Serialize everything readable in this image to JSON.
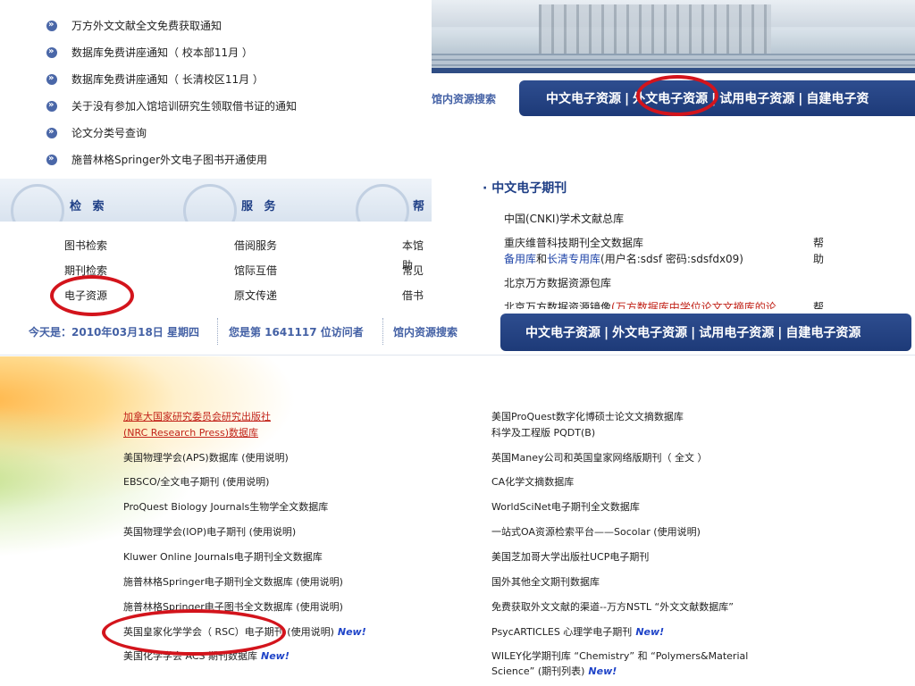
{
  "notices": [
    "万方外文文献全文免费获取通知",
    "数据库免费讲座通知（ 校本部11月 ）",
    "数据库免费讲座通知（ 长清校区11月 ）",
    "关于没有参加入馆培训研究生领取借书证的通知",
    "论文分类号查询",
    "施普林格Springer外文电子图书开通使用"
  ],
  "topnav": {
    "search_label": "馆内资源搜索",
    "items": [
      "中文电子资源",
      "外文电子资源",
      "试用电子资源",
      "自建电子资"
    ]
  },
  "menu": {
    "columns": [
      {
        "head": "检 索",
        "items": [
          "图书检索",
          "期刊检索",
          "电子资源"
        ]
      },
      {
        "head": "服 务",
        "items": [
          "借阅服务",
          "馆际互借",
          "原文传递"
        ]
      },
      {
        "head": "帮",
        "items": [
          "本馆助",
          "常见",
          "借书"
        ]
      }
    ]
  },
  "cjournal": {
    "title": "· 中文电子期刊",
    "rows": {
      "cnki": "中国(CNKI)学术文献总库",
      "weipu": "重庆维普科技期刊全文数据库",
      "backup": "备用库",
      "and": "和",
      "changqing": "长清专用库",
      "creds": "(用户名:sdsf 密码:sdsfdx09)",
      "wanfang": "北京万方数据资源包库",
      "mirror": "北京万方数据资源镜像",
      "mirror_red": "(万方数据库中学位论文文摘库的论",
      "help1": "帮",
      "help2": "助",
      "help3": "帮"
    }
  },
  "status": {
    "date": "今天是：2010年03月18日 星期四",
    "visitors": "您是第 1641117 位访问者",
    "search": "馆内资源搜索",
    "items": [
      "中文电子资源",
      "外文电子资源",
      "试用电子资源",
      "自建电子资源"
    ]
  },
  "foreign": {
    "left": {
      "nrc_line1": "加拿大国家研究委员会研究出版社",
      "nrc_line2": "(NRC Research Press)数据库",
      "items": [
        "美国物理学会(APS)数据库 (使用说明)",
        "EBSCO/全文电子期刊 (使用说明)",
        "ProQuest Biology Journals生物学全文数据库",
        "英国物理学会(IOP)电子期刊 (使用说明)",
        "Kluwer Online Journals电子期刊全文数据库",
        "施普林格Springer电子期刊全文数据库 (使用说明)",
        "施普林格Springer电子图书全文数据库 (使用说明)"
      ],
      "rsc": "英国皇家化学学会（ RSC）电子期刊 (使用说明)",
      "acs": "美国化学学会 ACS 期刊数据库"
    },
    "right": {
      "pqdt_line1": "美国ProQuest数字化博硕士论文文摘数据库",
      "pqdt_line2": "科学及工程版 PQDT(B)",
      "items": [
        "英国Maney公司和英国皇家网络版期刊（ 全文 ）",
        "CA化学文摘数据库",
        "WorldSciNet电子期刊全文数据库",
        "一站式OA资源检索平台——Socolar (使用说明)",
        "美国芝加哥大学出版社UCP电子期刊",
        "国外其他全文期刊数据库",
        "免费获取外文文献的渠道--万方NSTL “外文文献数据库”"
      ],
      "psyc": "PsycARTICLES 心理学电子期刊",
      "wiley_line1": "WILEY化学期刊库 “Chemistry” 和 “Polymers&Material",
      "wiley_line2": "Science” (期刊列表)"
    },
    "new_label": "New!"
  }
}
